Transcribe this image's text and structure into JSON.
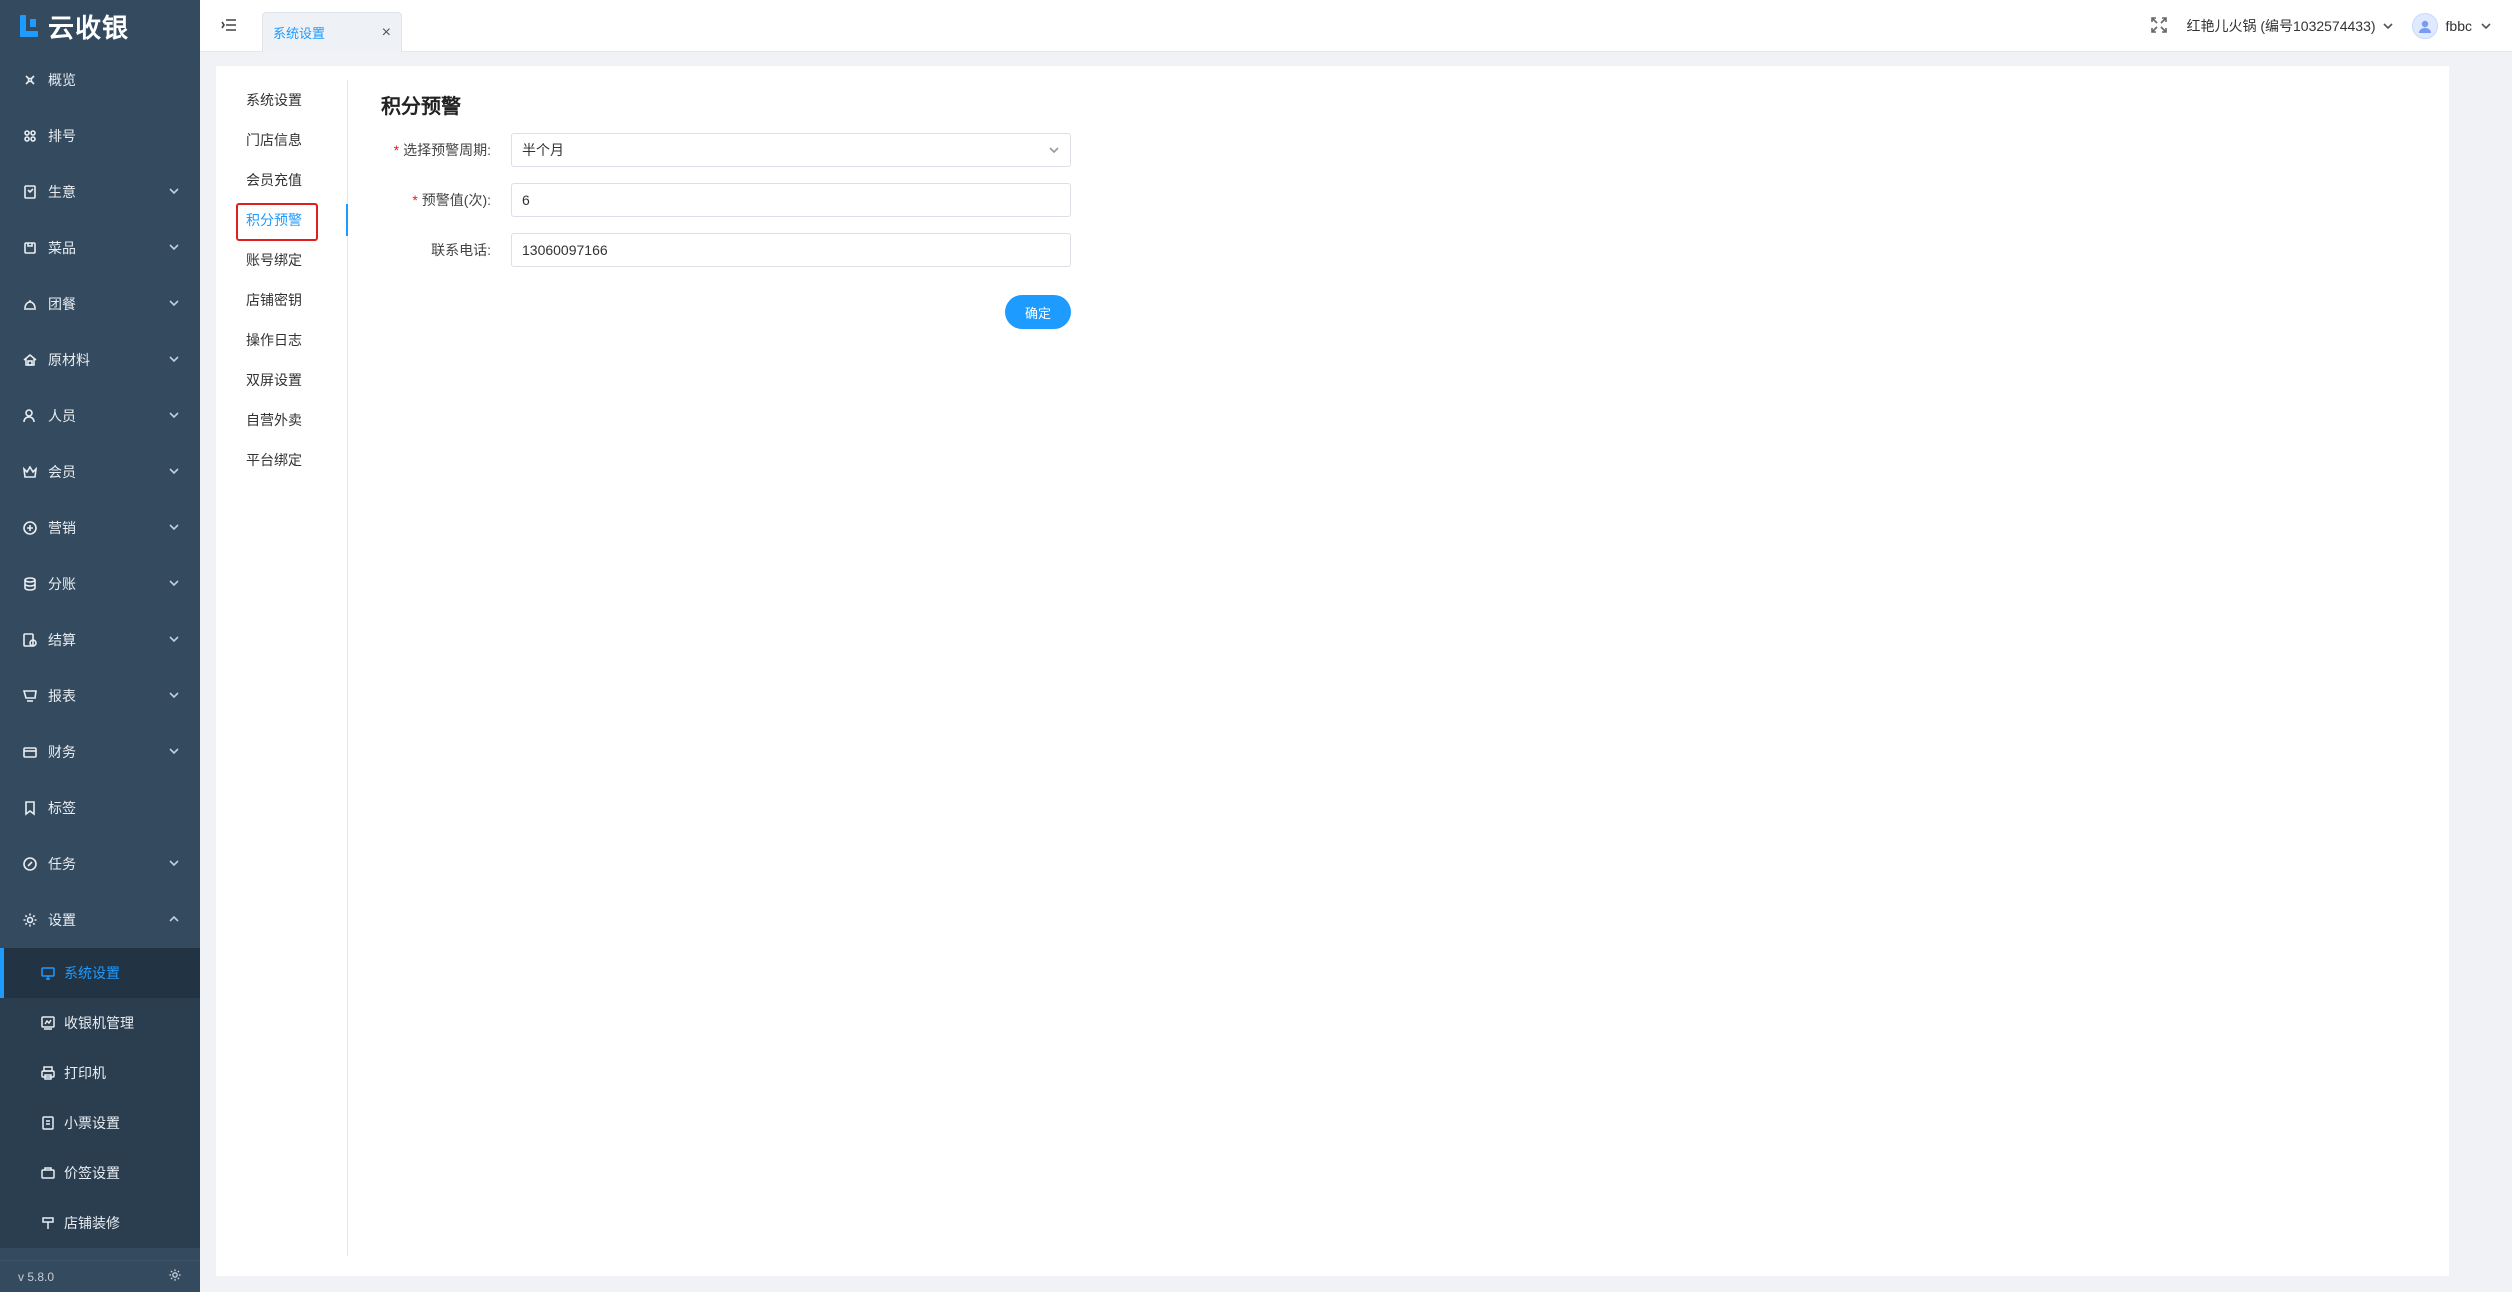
{
  "app": {
    "name": "云收银",
    "version": "v 5.8.0",
    "accent_color": "#1e9bff",
    "sidebar_color": "#344a5f"
  },
  "sidebar": {
    "items": [
      {
        "label": "概览",
        "icon": "overview-icon",
        "expandable": false
      },
      {
        "label": "排号",
        "icon": "queue-icon",
        "expandable": false
      },
      {
        "label": "生意",
        "icon": "business-icon",
        "expandable": true
      },
      {
        "label": "菜品",
        "icon": "dish-icon",
        "expandable": true
      },
      {
        "label": "团餐",
        "icon": "group-meal-icon",
        "expandable": true
      },
      {
        "label": "原材料",
        "icon": "material-icon",
        "expandable": true
      },
      {
        "label": "人员",
        "icon": "staff-icon",
        "expandable": true
      },
      {
        "label": "会员",
        "icon": "member-icon",
        "expandable": true
      },
      {
        "label": "营销",
        "icon": "marketing-icon",
        "expandable": true
      },
      {
        "label": "分账",
        "icon": "split-account-icon",
        "expandable": true
      },
      {
        "label": "结算",
        "icon": "settlement-icon",
        "expandable": true
      },
      {
        "label": "报表",
        "icon": "report-icon",
        "expandable": true
      },
      {
        "label": "财务",
        "icon": "finance-icon",
        "expandable": true
      },
      {
        "label": "标签",
        "icon": "tag-icon",
        "expandable": false
      },
      {
        "label": "任务",
        "icon": "task-icon",
        "expandable": true
      },
      {
        "label": "设置",
        "icon": "settings-icon",
        "expandable": true,
        "expanded": true
      }
    ],
    "settings_children": [
      {
        "label": "系统设置",
        "icon": "monitor-icon",
        "active": true
      },
      {
        "label": "收银机管理",
        "icon": "cashier-icon",
        "active": false
      },
      {
        "label": "打印机",
        "icon": "printer-icon",
        "active": false
      },
      {
        "label": "小票设置",
        "icon": "receipt-icon",
        "active": false
      },
      {
        "label": "价签设置",
        "icon": "price-tag-icon",
        "active": false
      },
      {
        "label": "店铺装修",
        "icon": "decoration-icon",
        "active": false
      }
    ]
  },
  "header": {
    "tab_label": "系统设置",
    "tab_close": "×",
    "store_name": "红艳儿火锅 (编号1032574433)",
    "username": "fbbc"
  },
  "subnav": {
    "items": [
      {
        "label": "系统设置",
        "active": false
      },
      {
        "label": "门店信息",
        "active": false
      },
      {
        "label": "会员充值",
        "active": false
      },
      {
        "label": "积分预警",
        "active": true
      },
      {
        "label": "账号绑定",
        "active": false
      },
      {
        "label": "店铺密钥",
        "active": false
      },
      {
        "label": "操作日志",
        "active": false
      },
      {
        "label": "双屏设置",
        "active": false
      },
      {
        "label": "自营外卖",
        "active": false
      },
      {
        "label": "平台绑定",
        "active": false
      }
    ]
  },
  "form": {
    "title": "积分预警",
    "period_label": "选择预警周期:",
    "period_value": "半个月",
    "threshold_label": "预警值(次):",
    "threshold_value": "6",
    "phone_label": "联系电话:",
    "phone_value": "13060097166",
    "required_mark": "*",
    "submit_label": "确定"
  }
}
